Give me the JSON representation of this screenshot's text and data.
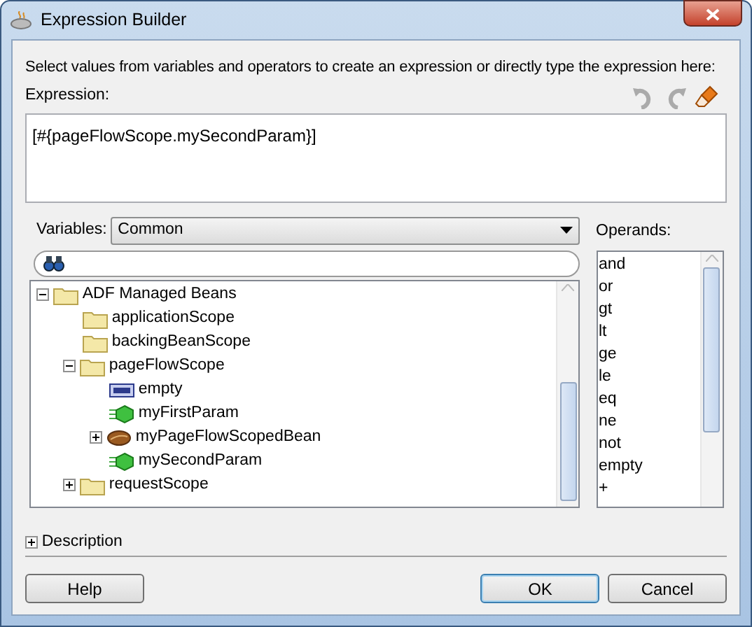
{
  "window": {
    "title": "Expression Builder"
  },
  "instruction": "Select values from variables and operators to create an expression or directly type the expression here:",
  "expression": {
    "label": "Expression:",
    "value": "[#{pageFlowScope.mySecondParam}]"
  },
  "variables": {
    "label": "Variables:",
    "value": "Common"
  },
  "tree": [
    {
      "label": "ADF Managed Beans",
      "kind": "folder",
      "expanded": true,
      "children": [
        {
          "label": "applicationScope",
          "kind": "folder"
        },
        {
          "label": "backingBeanScope",
          "kind": "folder"
        },
        {
          "label": "pageFlowScope",
          "kind": "folder",
          "expanded": true,
          "children": [
            {
              "label": "empty",
              "kind": "variable"
            },
            {
              "label": "myFirstParam",
              "kind": "param"
            },
            {
              "label": "myPageFlowScopedBean",
              "kind": "bean",
              "expanded": false
            },
            {
              "label": "mySecondParam",
              "kind": "param"
            }
          ]
        },
        {
          "label": "requestScope",
          "kind": "folder",
          "expanded": false
        }
      ]
    }
  ],
  "operands": {
    "label": "Operands:",
    "items": [
      "and",
      "or",
      "gt",
      "lt",
      "ge",
      "le",
      "eq",
      "ne",
      "not",
      "empty",
      "+"
    ]
  },
  "description": {
    "label": "Description",
    "expanded": false
  },
  "buttons": [
    {
      "label": "Help",
      "default": false
    },
    {
      "label": "OK",
      "default": true
    },
    {
      "label": "Cancel",
      "default": false
    }
  ]
}
